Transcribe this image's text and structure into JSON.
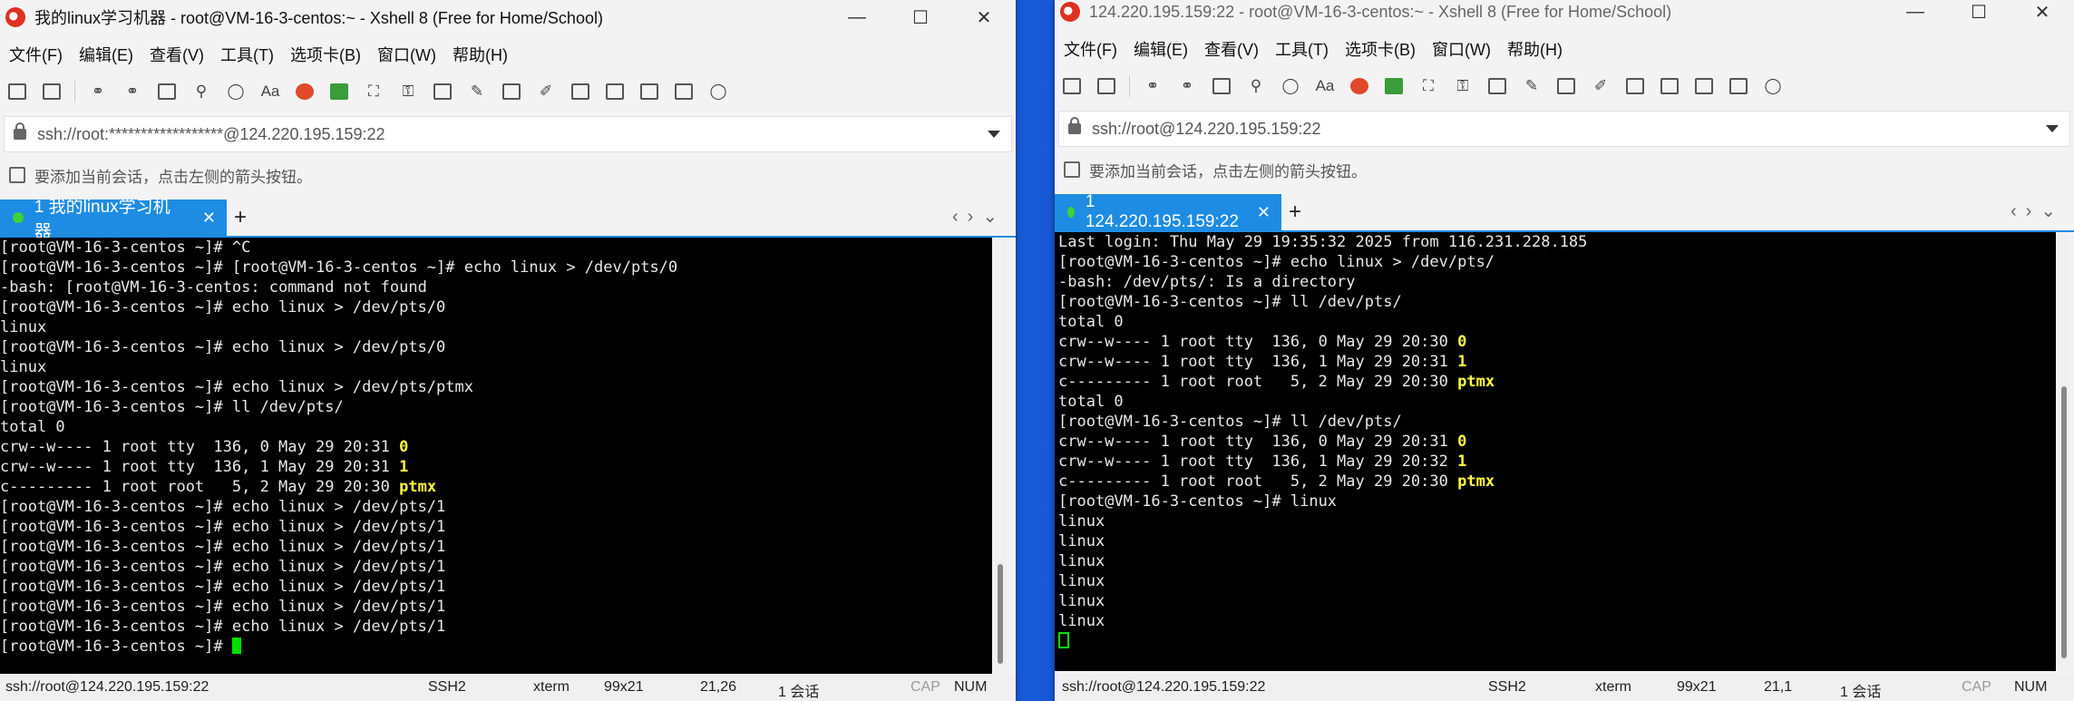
{
  "left": {
    "title": "我的linux学习机器 - root@VM-16-3-centos:~ - Xshell 8 (Free for Home/School)",
    "menu": [
      "文件(F)",
      "编辑(E)",
      "查看(V)",
      "工具(T)",
      "选项卡(B)",
      "窗口(W)",
      "帮助(H)"
    ],
    "address": "ssh://root:******************@124.220.195.159:22",
    "hint": "要添加当前会话，点击左侧的箭头按钮。",
    "tab_label": "1 我的linux学习机器",
    "terminal": [
      {
        "t": "[root@VM-16-3-centos ~]# ^C"
      },
      {
        "t": "[root@VM-16-3-centos ~]# [root@VM-16-3-centos ~]# echo linux > /dev/pts/0"
      },
      {
        "t": "-bash: [root@VM-16-3-centos: command not found"
      },
      {
        "t": "[root@VM-16-3-centos ~]# echo linux > /dev/pts/0"
      },
      {
        "t": "linux"
      },
      {
        "t": "[root@VM-16-3-centos ~]# echo linux > /dev/pts/0"
      },
      {
        "t": "linux"
      },
      {
        "t": "[root@VM-16-3-centos ~]# echo linux > /dev/pts/ptmx"
      },
      {
        "t": "[root@VM-16-3-centos ~]# ll /dev/pts/"
      },
      {
        "t": "total 0"
      },
      {
        "t": "crw--w---- 1 root tty  136, 0 May 29 20:31 ",
        "h": "0"
      },
      {
        "t": "crw--w---- 1 root tty  136, 1 May 29 20:31 ",
        "h": "1"
      },
      {
        "t": "c--------- 1 root root   5, 2 May 29 20:30 ",
        "h": "ptmx"
      },
      {
        "t": "[root@VM-16-3-centos ~]# echo linux > /dev/pts/1"
      },
      {
        "t": "[root@VM-16-3-centos ~]# echo linux > /dev/pts/1"
      },
      {
        "t": "[root@VM-16-3-centos ~]# echo linux > /dev/pts/1"
      },
      {
        "t": "[root@VM-16-3-centos ~]# echo linux > /dev/pts/1"
      },
      {
        "t": "[root@VM-16-3-centos ~]# echo linux > /dev/pts/1"
      },
      {
        "t": "[root@VM-16-3-centos ~]# echo linux > /dev/pts/1"
      },
      {
        "t": "[root@VM-16-3-centos ~]# echo linux > /dev/pts/1"
      },
      {
        "t": "[root@VM-16-3-centos ~]# ",
        "cursor": "filled"
      }
    ],
    "status": {
      "addr": "ssh://root@124.220.195.159:22",
      "proto": "SSH2",
      "term": "xterm",
      "size": "99x21",
      "pos": "21,26",
      "sessions": "1 会话",
      "cap": "CAP",
      "num": "NUM"
    }
  },
  "right": {
    "title": "124.220.195.159:22 - root@VM-16-3-centos:~ - Xshell 8 (Free for Home/School)",
    "menu": [
      "文件(F)",
      "编辑(E)",
      "查看(V)",
      "工具(T)",
      "选项卡(B)",
      "窗口(W)",
      "帮助(H)"
    ],
    "address": "ssh://root@124.220.195.159:22",
    "hint": "要添加当前会话，点击左侧的箭头按钮。",
    "tab_label": "1 124.220.195.159:22",
    "terminal": [
      {
        "t": "Last login: Thu May 29 19:35:32 2025 from 116.231.228.185"
      },
      {
        "t": "[root@VM-16-3-centos ~]# echo linux > /dev/pts/"
      },
      {
        "t": "-bash: /dev/pts/: Is a directory"
      },
      {
        "t": "[root@VM-16-3-centos ~]# ll /dev/pts/"
      },
      {
        "t": "total 0"
      },
      {
        "t": "crw--w---- 1 root tty  136, 0 May 29 20:30 ",
        "h": "0"
      },
      {
        "t": "crw--w---- 1 root tty  136, 1 May 29 20:31 ",
        "h": "1"
      },
      {
        "t": "c--------- 1 root root   5, 2 May 29 20:30 ",
        "h": "ptmx"
      },
      {
        "t": "total 0"
      },
      {
        "t": "[root@VM-16-3-centos ~]# ll /dev/pts/"
      },
      {
        "t": "crw--w---- 1 root tty  136, 0 May 29 20:31 ",
        "h": "0"
      },
      {
        "t": "crw--w---- 1 root tty  136, 1 May 29 20:32 ",
        "h": "1"
      },
      {
        "t": "c--------- 1 root root   5, 2 May 29 20:30 ",
        "h": "ptmx"
      },
      {
        "t": "[root@VM-16-3-centos ~]# linux"
      },
      {
        "t": "linux"
      },
      {
        "t": "linux"
      },
      {
        "t": "linux"
      },
      {
        "t": "linux"
      },
      {
        "t": "linux"
      },
      {
        "t": "linux"
      },
      {
        "t": "",
        "cursor": "hollow"
      }
    ],
    "status": {
      "addr": "ssh://root@124.220.195.159:22",
      "proto": "SSH2",
      "term": "xterm",
      "size": "99x21",
      "pos": "21,1",
      "sessions": "1 会话",
      "cap": "CAP",
      "num": "NUM"
    }
  },
  "colors": {
    "tab_active": "#1e8ce3",
    "terminal_bg": "#000000",
    "terminal_fg": "#e8e8e8",
    "highlight": "#ffff40",
    "cursor": "#00e000",
    "session_dot": "#3bd23b"
  }
}
